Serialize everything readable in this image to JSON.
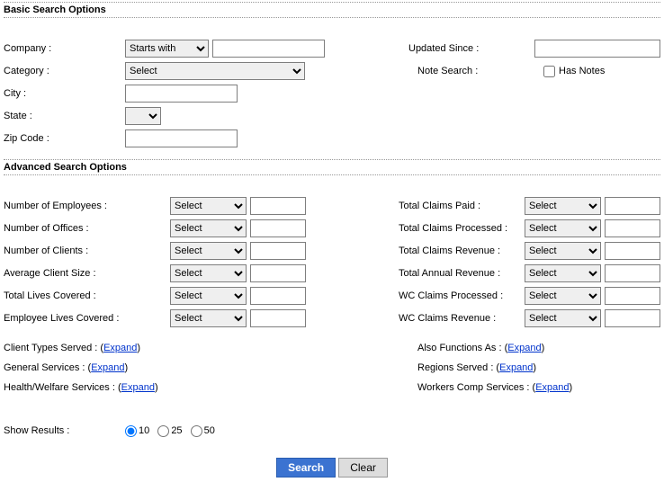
{
  "basic": {
    "header": "Basic Search Options",
    "company_label": "Company :",
    "company_op": "Starts with",
    "category_label": "Category :",
    "category_value": "Select",
    "city_label": "City :",
    "state_label": "State :",
    "zip_label": "Zip Code :",
    "updated_label": "Updated Since :",
    "note_label": "Note Search :",
    "has_notes": "Has Notes"
  },
  "advanced": {
    "header": "Advanced Search Options",
    "select_text": "Select",
    "left": {
      "employees": "Number of Employees :",
      "offices": "Number of Offices :",
      "clients": "Number of Clients :",
      "avg_client": "Average Client Size :",
      "total_lives": "Total Lives Covered :",
      "emp_lives": "Employee Lives Covered :"
    },
    "right": {
      "claims_paid": "Total Claims Paid :",
      "claims_processed": "Total Claims Processed :",
      "claims_revenue": "Total Claims Revenue :",
      "annual_revenue": "Total Annual Revenue :",
      "wc_processed": "WC Claims Processed :",
      "wc_revenue": "WC Claims Revenue :"
    }
  },
  "expands": {
    "text": "Expand",
    "client_types": "Client Types Served : (",
    "general_services": "General Services : (",
    "health_welfare": "Health/Welfare Services : (",
    "also_functions": "Also Functions As : (",
    "regions_served": "Regions Served : (",
    "wc_services": "Workers Comp Services : (",
    "close": ")"
  },
  "results": {
    "label": "Show Results :",
    "opt10": "10",
    "opt25": "25",
    "opt50": "50"
  },
  "buttons": {
    "search": "Search",
    "clear": "Clear"
  }
}
